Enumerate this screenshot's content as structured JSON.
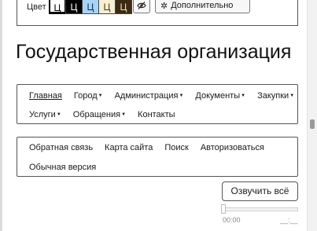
{
  "accessibility": {
    "color_label": "Цвет",
    "swatches": [
      {
        "label": "Ц",
        "bg": "#ffffff",
        "fg": "#000000"
      },
      {
        "label": "Ц",
        "bg": "#000000",
        "fg": "#ffffff"
      },
      {
        "label": "Ц",
        "bg": "#a7d3f5",
        "fg": "#063462"
      },
      {
        "label": "Ц",
        "bg": "#f6efd2",
        "fg": "#4b3a1c"
      },
      {
        "label": "Ц",
        "bg": "#3b2b13",
        "fg": "#ede1b8"
      }
    ],
    "hide_images_icon": "eye-slash-icon",
    "more_icon": "gear-icon",
    "more_label": "Дополнительно"
  },
  "site_title": "Государственная организация",
  "main_menu": {
    "row1": [
      {
        "label": "Главная",
        "active": true,
        "dropdown": false
      },
      {
        "label": "Город",
        "dropdown": true
      },
      {
        "label": "Администрация",
        "dropdown": true
      },
      {
        "label": "Документы",
        "dropdown": true
      },
      {
        "label": "Закупки",
        "dropdown": true
      }
    ],
    "row2": [
      {
        "label": "Услуги",
        "dropdown": true
      },
      {
        "label": "Обращения",
        "dropdown": true
      },
      {
        "label": "Контакты",
        "dropdown": false
      }
    ]
  },
  "secondary_menu": {
    "row1": [
      "Обратная связь",
      "Карта сайта",
      "Поиск",
      "Авторизоваться"
    ],
    "row2": [
      "Обычная версия"
    ]
  },
  "speak_button_label": "Озвучить всё",
  "player": {
    "time_current": "00:00",
    "time_total": "__:__",
    "progress": 0
  }
}
